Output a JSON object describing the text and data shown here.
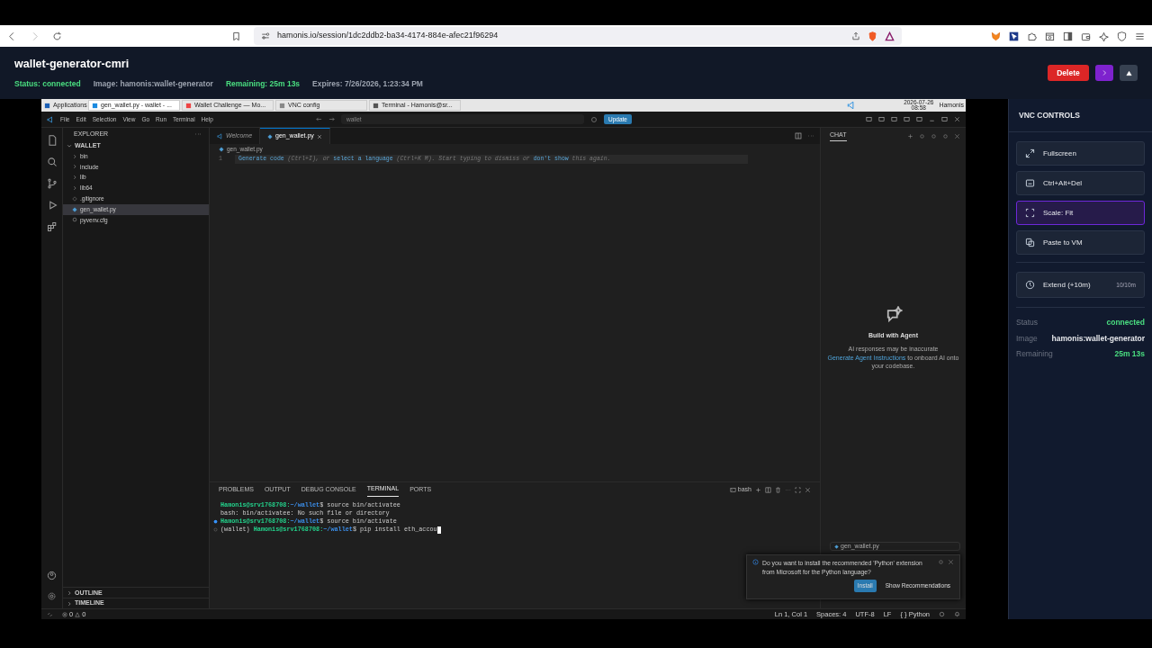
{
  "browser": {
    "url": "hamonis.io/session/1dc2ddb2-ba34-4174-884e-afec21f96294"
  },
  "header": {
    "title": "wallet-generator-cmri",
    "meta": [
      {
        "text": "Status: connected",
        "color": "#4ade80"
      },
      {
        "text": "Image: hamonis:wallet-generator",
        "color": "#9ca3af"
      },
      {
        "text": "Remaining: 25m 13s",
        "color": "#4ade80"
      },
      {
        "text": "Expires: 7/26/2026, 1:23:34 PM",
        "color": "#9ca3af"
      }
    ],
    "actions": [
      {
        "kind": "delete",
        "label": "Delete"
      },
      {
        "kind": "next"
      },
      {
        "kind": "collapse"
      }
    ]
  },
  "vm": {
    "taskbar": {
      "items": [
        {
          "label": "Applications",
          "kind": "menu",
          "selected": false
        },
        {
          "label": "gen_wallet.py - wallet - ...",
          "kind": "vscode",
          "selected": true
        },
        {
          "label": "Wallet Challenge — Mo...",
          "kind": "browser",
          "selected": false
        },
        {
          "label": "VNC config",
          "kind": "window",
          "selected": false
        },
        {
          "label": "Terminal - Hamonis@sr...",
          "kind": "terminal",
          "selected": false
        }
      ],
      "date": "2026-07-26",
      "time": "08:58",
      "user": "Hamonis"
    },
    "vscode": {
      "menu": [
        "File",
        "Edit",
        "Selection",
        "View",
        "Go",
        "Run",
        "Terminal",
        "Help"
      ],
      "search": "wallet",
      "update": "Update",
      "explorer": {
        "title": "EXPLORER",
        "folder": "WALLET",
        "items": [
          {
            "label": "bin",
            "kind": "folder",
            "selected": false
          },
          {
            "label": "include",
            "kind": "folder",
            "selected": false
          },
          {
            "label": "lib",
            "kind": "folder",
            "selected": false
          },
          {
            "label": "lib64",
            "kind": "folder",
            "selected": false
          },
          {
            "label": ".gitignore",
            "kind": "file",
            "selected": false
          },
          {
            "label": "gen_wallet.py",
            "kind": "python",
            "selected": true
          },
          {
            "label": "pyvenv.cfg",
            "kind": "config",
            "selected": false
          }
        ],
        "sections": [
          "OUTLINE",
          "TIMELINE"
        ]
      },
      "tabs": [
        {
          "label": "Welcome",
          "kind": "welcome",
          "selected": false
        },
        {
          "label": "gen_wallet.py",
          "kind": "python",
          "selected": true
        }
      ],
      "breadcrumb": "gen_wallet.py",
      "line_number": "1",
      "hint": [
        {
          "text": "Generate code",
          "kind": "link"
        },
        {
          "text": " (Ctrl+I), or ",
          "kind": "plain"
        },
        {
          "text": "select a language",
          "kind": "link"
        },
        {
          "text": " (Ctrl+K M). Start typing to dismiss or ",
          "kind": "plain"
        },
        {
          "text": "don't show",
          "kind": "link"
        },
        {
          "text": " this again.",
          "kind": "plain"
        }
      ],
      "panel_tabs": [
        {
          "label": "PROBLEMS",
          "selected": false
        },
        {
          "label": "OUTPUT",
          "selected": false
        },
        {
          "label": "DEBUG CONSOLE",
          "selected": false
        },
        {
          "label": "TERMINAL",
          "selected": true
        },
        {
          "label": "PORTS",
          "selected": false
        }
      ],
      "shell": "bash",
      "terminal": [
        {
          "kind": "prompt",
          "user": "Hamonis@srv1768708",
          "separator": ":",
          "path": "~/wallet",
          "symbol": "$",
          "command": "source bin/activatee",
          "cursor": false
        },
        {
          "kind": "output",
          "text": "bash: bin/activatee: No such file or directory"
        },
        {
          "kind": "finished_prompt",
          "user": "Hamonis@srv1768708",
          "separator": ":",
          "path": "~/wallet",
          "symbol": "$",
          "command": "source bin/activate",
          "cursor": false
        },
        {
          "kind": "current_prompt",
          "prefix": "(wallet)",
          "user": "Hamonis@srv1768708",
          "separator": ":",
          "path": "~/wallet",
          "symbol": "$",
          "command": "pip install eth_accou",
          "cursor": true
        }
      ],
      "chat": {
        "title": "CHAT",
        "heading": "Build with Agent",
        "note": "AI responses may be inaccurate",
        "link": "Generate Agent Instructions",
        "text": " to onboard AI onto your codebase.",
        "attachment": "gen_wallet.py"
      },
      "notification": {
        "message": "Do you want to install the recommended 'Python' extension from Microsoft for the Python language?",
        "buttons": [
          {
            "label": "Install",
            "kind": "primary"
          },
          {
            "label": "Show Recommendations",
            "kind": "secondary"
          }
        ]
      },
      "status_bar": {
        "errors": "0",
        "warnings": "0",
        "items": [
          "Ln 1, Col 1",
          "Spaces: 4",
          "UTF-8",
          "LF",
          "{ } Python"
        ]
      }
    }
  },
  "vnc_panel": {
    "title": "VNC CONTROLS",
    "controls": [
      {
        "label": "Fullscreen",
        "kind": "fullscreen",
        "selected": false
      },
      {
        "label": "Ctrl+Alt+Del",
        "kind": "keys",
        "selected": false
      },
      {
        "label": "Scale: Fit",
        "kind": "scale",
        "selected": true
      },
      {
        "label": "Paste to VM",
        "kind": "paste",
        "selected": false
      }
    ],
    "extend": {
      "label": "Extend (+10m)",
      "count": "10/10m"
    },
    "info": [
      {
        "label": "Status",
        "value": "connected",
        "color": "#4ade80"
      },
      {
        "label": "Image",
        "value": "hamonis:wallet-generator",
        "color": "#e5e7eb"
      },
      {
        "label": "Remaining",
        "value": "25m 13s",
        "color": "#4ade80"
      }
    ]
  }
}
